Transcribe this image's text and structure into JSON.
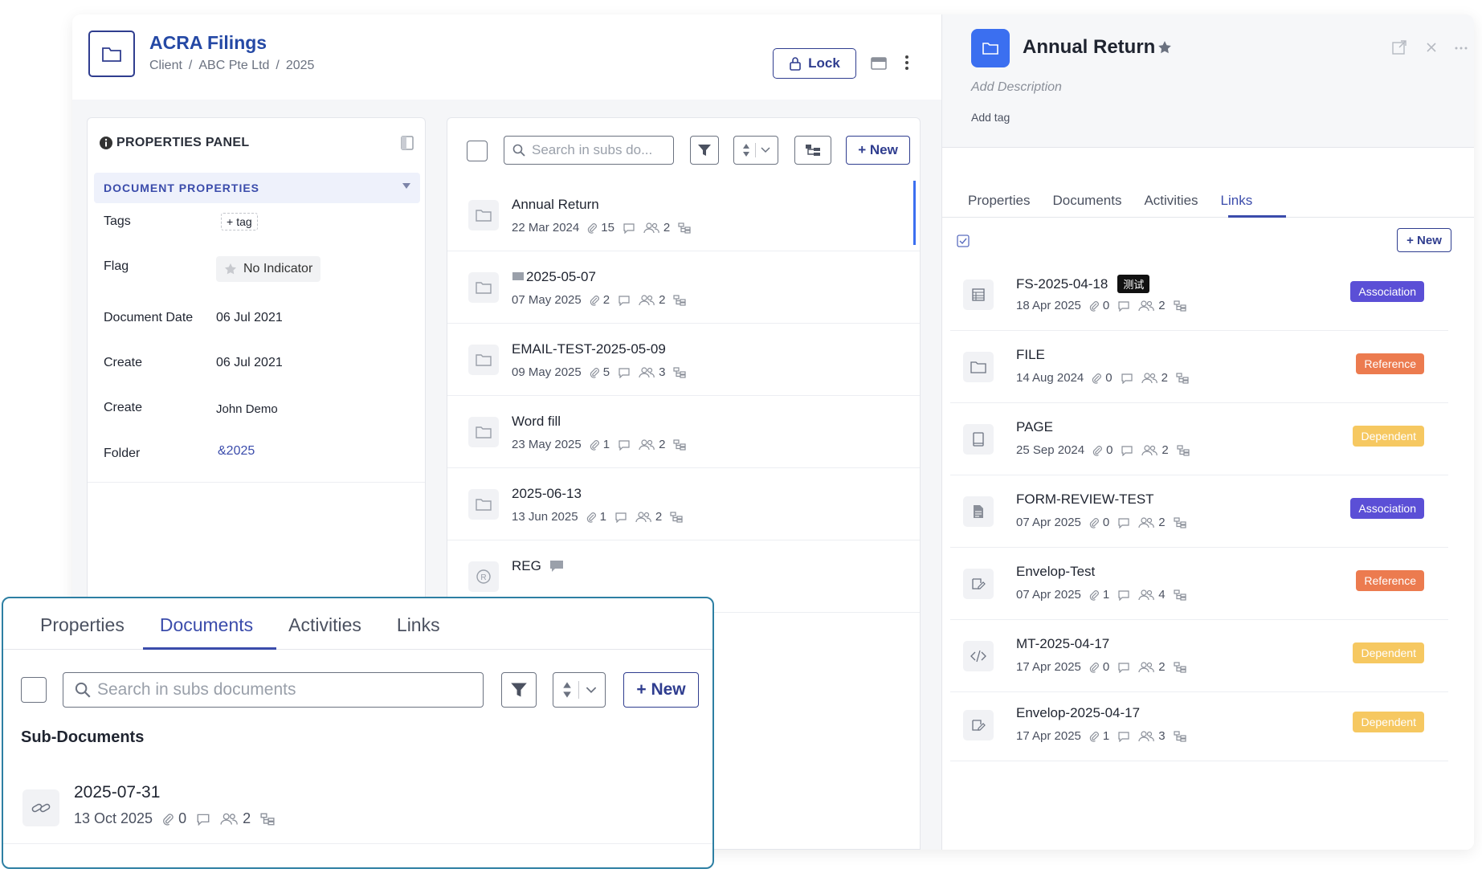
{
  "header": {
    "title": "ACRA Filings",
    "breadcrumb": [
      "Client",
      "ABC Pte Ltd",
      "2025"
    ],
    "separator": "/",
    "lock_label": "Lock"
  },
  "properties_panel": {
    "title": "PROPERTIES PANEL",
    "section_title": "DOCUMENT PROPERTIES",
    "rows": [
      {
        "label": "Tags",
        "value": "tag"
      },
      {
        "label": "Flag",
        "value": "No Indicator"
      },
      {
        "label": "Document Date",
        "value": "06 Jul 2021"
      },
      {
        "label": "Create",
        "value": "06 Jul 2021"
      },
      {
        "label": "Create",
        "value": "John Demo"
      },
      {
        "label": "Folder",
        "value": "&2025"
      }
    ]
  },
  "list_panel": {
    "search_placeholder": "Search in subs do...",
    "new_label": "+ New",
    "items": [
      {
        "title": "Annual Return",
        "date": "22 Mar 2024",
        "attachments": "15",
        "members": "2"
      },
      {
        "title": "2025-05-07",
        "date": "07 May 2025",
        "attachments": "2",
        "members": "2"
      },
      {
        "title": "EMAIL-TEST-2025-05-09",
        "date": "09 May 2025",
        "attachments": "5",
        "members": "3"
      },
      {
        "title": "Word fill",
        "date": "23 May 2025",
        "attachments": "1",
        "members": "2"
      },
      {
        "title": "2025-06-13",
        "date": "13 Jun 2025",
        "attachments": "1",
        "members": "2"
      },
      {
        "title": "REG",
        "date": "",
        "attachments": "",
        "members": ""
      }
    ]
  },
  "detail": {
    "title": "Annual Return",
    "description_placeholder": "Add Description",
    "add_tag": "Add tag",
    "tabs": [
      "Properties",
      "Documents",
      "Activities",
      "Links"
    ],
    "active_tab": "Links",
    "new_label": "+ New",
    "links": [
      {
        "title": "FS-2025-04-18",
        "tag": "测试",
        "date": "18 Apr 2025",
        "attachments": "0",
        "members": "2",
        "type": "Association",
        "icon": "table-icon"
      },
      {
        "title": "FILE",
        "tag": "",
        "date": "14 Aug 2024",
        "attachments": "0",
        "members": "2",
        "type": "Reference",
        "icon": "folder-icon"
      },
      {
        "title": "PAGE",
        "tag": "",
        "date": "25 Sep 2024",
        "attachments": "0",
        "members": "2",
        "type": "Dependent",
        "icon": "book-icon"
      },
      {
        "title": "FORM-REVIEW-TEST",
        "tag": "",
        "date": "07 Apr 2025",
        "attachments": "0",
        "members": "2",
        "type": "Association",
        "icon": "form-icon"
      },
      {
        "title": "Envelop-Test",
        "tag": "",
        "date": "07 Apr 2025",
        "attachments": "1",
        "members": "4",
        "type": "Reference",
        "icon": "signature-icon"
      },
      {
        "title": "MT-2025-04-17",
        "tag": "",
        "date": "17 Apr 2025",
        "attachments": "0",
        "members": "2",
        "type": "Dependent",
        "icon": "code-icon"
      },
      {
        "title": "Envelop-2025-04-17",
        "tag": "",
        "date": "17 Apr 2025",
        "attachments": "1",
        "members": "3",
        "type": "Dependent",
        "icon": "signature-icon"
      }
    ]
  },
  "overlay": {
    "tabs": [
      "Properties",
      "Documents",
      "Activities",
      "Links"
    ],
    "active_tab": "Documents",
    "search_placeholder": "Search in subs documents",
    "new_label": "+ New",
    "section_title": "Sub-Documents",
    "item": {
      "title": "2025-07-31",
      "date": "13 Oct 2025",
      "attachments": "0",
      "members": "2"
    }
  },
  "colors": {
    "accent": "#3b4cab",
    "association": "#5b4fd6",
    "reference": "#ec7b4f",
    "dependent": "#f6c861",
    "overlay_border": "#2d7fa3"
  }
}
